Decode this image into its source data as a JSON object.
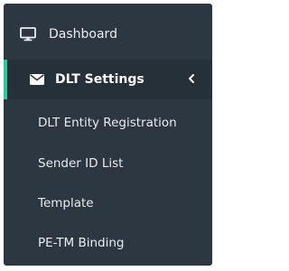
{
  "sidebar": {
    "items": [
      {
        "label": "Dashboard",
        "icon": "monitor-icon"
      },
      {
        "label": "DLT Settings",
        "icon": "envelope-icon",
        "expanded": true,
        "active": true
      }
    ],
    "submenu": [
      {
        "label": "DLT Entity Registration"
      },
      {
        "label": "Sender ID List"
      },
      {
        "label": "Template"
      },
      {
        "label": "PE-TM Binding"
      }
    ]
  },
  "colors": {
    "sidebar_background": "#2d3741",
    "active_background": "#263038",
    "active_accent": "#2cc99b",
    "text": "#ffffff"
  }
}
